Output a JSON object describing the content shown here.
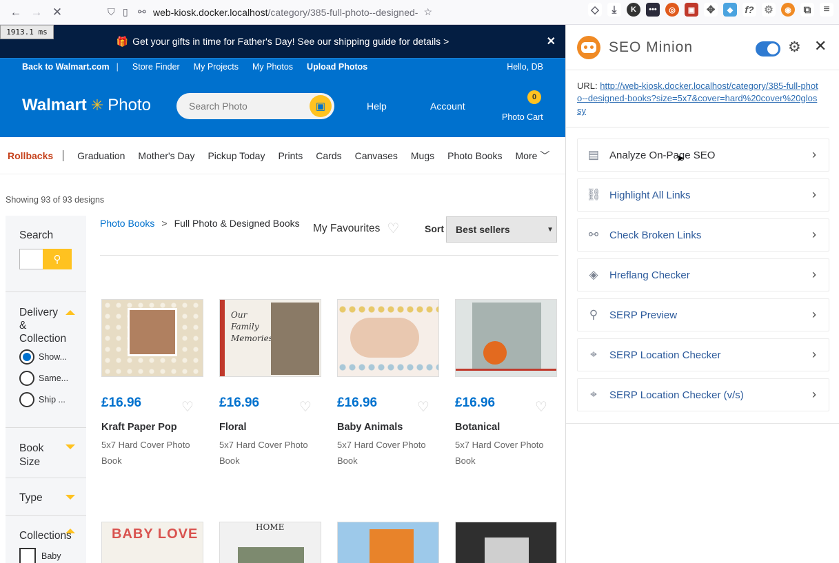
{
  "browser": {
    "url_host": "web-kiosk.docker.localhost",
    "url_path": "/category/385-full-photo--designed-",
    "timer": "1913.1 ms"
  },
  "promo": {
    "text": "Get your gifts in time for Father's Day! See our shipping guide for details >"
  },
  "utilbar": {
    "back": "Back to Walmart.com",
    "items": [
      "Store Finder",
      "My Projects",
      "My Photos",
      "Upload Photos"
    ],
    "hello": "Hello, DB"
  },
  "header": {
    "logo_brand": "Walmart",
    "logo_product": "Photo",
    "search_placeholder": "Search Photo",
    "help": "Help",
    "account": "Account",
    "cart_count": "0",
    "cart_label": "Photo Cart"
  },
  "catnav": {
    "rollbacks": "Rollbacks",
    "items": [
      "Graduation",
      "Mother's Day",
      "Pickup Today",
      "Prints",
      "Cards",
      "Canvases",
      "Mugs",
      "Photo Books",
      "More"
    ]
  },
  "showing": "Showing 93 of 93 designs",
  "sidebar": {
    "search_title": "Search",
    "delivery_title": "Delivery & Collection",
    "delivery_options": [
      "Show...",
      "Same...",
      "Ship ..."
    ],
    "book_size": "Book Size",
    "type": "Type",
    "collections": "Collections",
    "collection_items": [
      "Baby"
    ]
  },
  "breadcrumb": {
    "root": "Photo Books",
    "current": "Full Photo & Designed Books"
  },
  "favourites": "My Favourites",
  "sort": {
    "label": "Sort",
    "value": "Best sellers"
  },
  "products": [
    {
      "price": "£16.96",
      "name": "Kraft Paper Pop",
      "desc": "5x7 Hard Cover Photo Book"
    },
    {
      "price": "£16.96",
      "name": "Floral",
      "desc": "5x7 Hard Cover Photo Book"
    },
    {
      "price": "£16.96",
      "name": "Baby Animals",
      "desc": "5x7 Hard Cover Photo Book"
    },
    {
      "price": "£16.96",
      "name": "Botanical",
      "desc": "5x7 Hard Cover Photo Book"
    }
  ],
  "second_row_text": {
    "baby_love": "BABY LOVE",
    "home": "HOME"
  },
  "panel": {
    "title": "SEO Minion",
    "url_label": "URL:",
    "url": "http://web-kiosk.docker.localhost/category/385-full-photo--designed-books?size=5x7&cover=hard%20cover%20glossy",
    "items": [
      {
        "label": "Analyze On-Page SEO",
        "icon": "analyze-icon"
      },
      {
        "label": "Highlight All Links",
        "icon": "link-icon"
      },
      {
        "label": "Check Broken Links",
        "icon": "broken-link-icon"
      },
      {
        "label": "Hreflang Checker",
        "icon": "tag-icon"
      },
      {
        "label": "SERP Preview",
        "icon": "search-icon"
      },
      {
        "label": "SERP Location Checker",
        "icon": "location-icon"
      },
      {
        "label": "SERP Location Checker (v/s)",
        "icon": "location-icon"
      }
    ]
  }
}
